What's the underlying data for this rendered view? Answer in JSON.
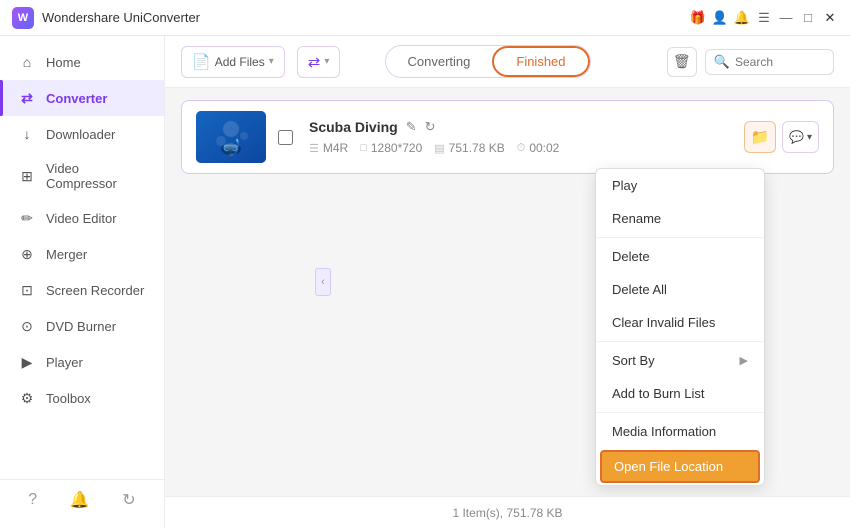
{
  "titlebar": {
    "app_name": "Wondershare UniConverter",
    "logo_text": "W"
  },
  "titlebar_controls": {
    "gift_icon": "🎁",
    "user_icon": "👤",
    "bell_icon": "🔔",
    "menu_icon": "☰",
    "minimize_icon": "—",
    "maximize_icon": "□",
    "close_icon": "✕"
  },
  "sidebar": {
    "items": [
      {
        "id": "home",
        "label": "Home",
        "icon": "⌂"
      },
      {
        "id": "converter",
        "label": "Converter",
        "icon": "⇄",
        "active": true
      },
      {
        "id": "downloader",
        "label": "Downloader",
        "icon": "↓"
      },
      {
        "id": "video-compressor",
        "label": "Video Compressor",
        "icon": "⊞"
      },
      {
        "id": "video-editor",
        "label": "Video Editor",
        "icon": "✏"
      },
      {
        "id": "merger",
        "label": "Merger",
        "icon": "⊕"
      },
      {
        "id": "screen-recorder",
        "label": "Screen Recorder",
        "icon": "⊡"
      },
      {
        "id": "dvd-burner",
        "label": "DVD Burner",
        "icon": "⊙"
      },
      {
        "id": "player",
        "label": "Player",
        "icon": "▶"
      },
      {
        "id": "toolbox",
        "label": "Toolbox",
        "icon": "⚙"
      }
    ],
    "bottom_icons": [
      "?",
      "🔔",
      "↻"
    ]
  },
  "toolbar": {
    "add_files_label": "Add Files",
    "add_icon": "+",
    "convert_icon": "⇄",
    "tabs": {
      "converting_label": "Converting",
      "finished_label": "Finished"
    },
    "search_placeholder": "Search"
  },
  "file_item": {
    "name": "Scuba Diving",
    "format": "M4R",
    "resolution": "1280*720",
    "size": "751.78 KB",
    "duration": "00:02",
    "checkbox_checked": false
  },
  "context_menu": {
    "items": [
      {
        "id": "play",
        "label": "Play",
        "has_arrow": false
      },
      {
        "id": "rename",
        "label": "Rename",
        "has_arrow": false
      },
      {
        "id": "delete",
        "label": "Delete",
        "has_arrow": false
      },
      {
        "id": "delete-all",
        "label": "Delete All",
        "has_arrow": false
      },
      {
        "id": "clear-invalid",
        "label": "Clear Invalid Files",
        "has_arrow": false
      },
      {
        "id": "sort-by",
        "label": "Sort By",
        "has_arrow": true
      },
      {
        "id": "add-to-burn",
        "label": "Add to Burn List",
        "has_arrow": false
      },
      {
        "id": "media-info",
        "label": "Media Information",
        "has_arrow": false
      },
      {
        "id": "open-location",
        "label": "Open File Location",
        "has_arrow": false,
        "highlighted": true
      }
    ]
  },
  "statusbar": {
    "text": "1 Item(s), 751.78 KB"
  },
  "colors": {
    "accent_purple": "#7c3aed",
    "accent_orange": "#e06b2a",
    "border_purple": "#d8c8f5",
    "highlight_orange": "#f0a030"
  }
}
